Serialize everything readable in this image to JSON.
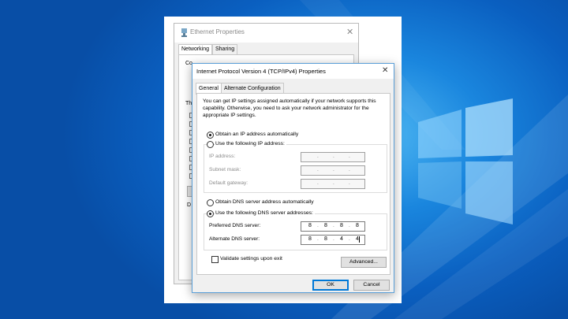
{
  "ethernet_window": {
    "title": "Ethernet Properties",
    "tabs": [
      {
        "label": "Networking"
      },
      {
        "label": "Sharing"
      }
    ],
    "partial_labels": [
      "Co",
      "Th",
      "D"
    ]
  },
  "ipv4_dialog": {
    "title": "Internet Protocol Version 4 (TCP/IPv4) Properties",
    "tabs": [
      {
        "label": "General"
      },
      {
        "label": "Alternate Configuration"
      }
    ],
    "intro": "You can get IP settings assigned automatically if your network supports this capability. Otherwise, you need to ask your network administrator for the appropriate IP settings.",
    "ip_section": {
      "auto_label": "Obtain an IP address automatically",
      "manual_label": "Use the following IP address:",
      "fields": [
        {
          "label": "IP address:",
          "octets": [
            "",
            "",
            "",
            ""
          ]
        },
        {
          "label": "Subnet mask:",
          "octets": [
            "",
            "",
            "",
            ""
          ]
        },
        {
          "label": "Default gateway:",
          "octets": [
            "",
            "",
            "",
            ""
          ]
        }
      ]
    },
    "dns_section": {
      "auto_label": "Obtain DNS server address automatically",
      "manual_label": "Use the following DNS server addresses:",
      "fields": [
        {
          "label": "Preferred DNS server:",
          "octets": [
            "8",
            "8",
            "8",
            "8"
          ]
        },
        {
          "label": "Alternate DNS server:",
          "octets": [
            "8",
            "8",
            "4",
            "4"
          ]
        }
      ]
    },
    "validate_label": "Validate settings upon exit",
    "advanced_label": "Advanced...",
    "ok_label": "OK",
    "cancel_label": "Cancel"
  },
  "icons": {
    "ethernet": "network-adapter-icon",
    "close": "close-icon"
  },
  "colors": {
    "desktop_blue": "#0a5fc0",
    "accent": "#0078d7",
    "window_bg": "#f0f0f0"
  }
}
